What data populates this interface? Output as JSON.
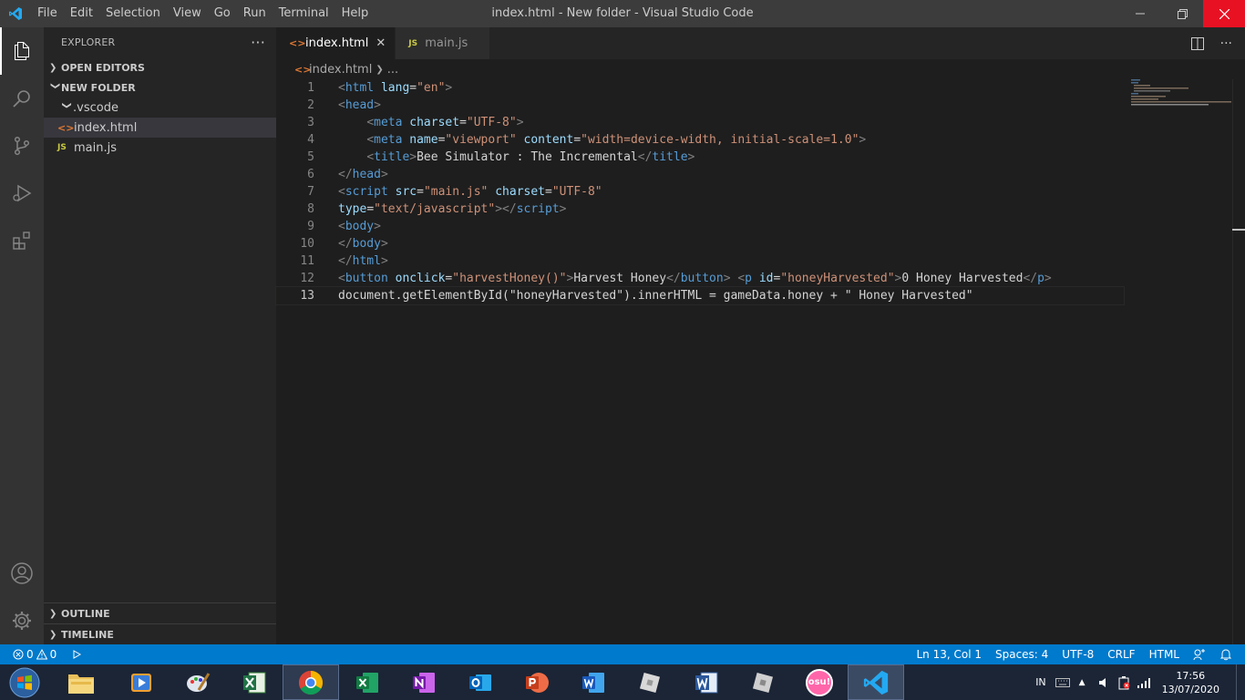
{
  "titlebar": {
    "menu": [
      "File",
      "Edit",
      "Selection",
      "View",
      "Go",
      "Run",
      "Terminal",
      "Help"
    ],
    "title": "index.html - New folder - Visual Studio Code"
  },
  "sidebar": {
    "header": "EXPLORER",
    "more": "···",
    "open_editors": "OPEN EDITORS",
    "folder": "NEW FOLDER",
    "items": [
      {
        "label": ".vscode",
        "type": "folder"
      },
      {
        "label": "index.html",
        "type": "html",
        "icon": "<>"
      },
      {
        "label": "main.js",
        "type": "js",
        "icon": "JS"
      }
    ],
    "outline": "OUTLINE",
    "timeline": "TIMELINE"
  },
  "tabs": [
    {
      "label": "index.html",
      "icon": "<>",
      "active": true
    },
    {
      "label": "main.js",
      "icon": "JS",
      "active": false
    }
  ],
  "breadcrumb": {
    "file": "index.html",
    "rest": "..."
  },
  "code": {
    "current_line": 13,
    "lines": [
      [
        {
          "c": "t",
          "s": "<"
        },
        {
          "c": "tag",
          "s": "html"
        },
        {
          "c": "plain",
          "s": " "
        },
        {
          "c": "attr",
          "s": "lang"
        },
        {
          "c": "plain",
          "s": "="
        },
        {
          "c": "str",
          "s": "\"en\""
        },
        {
          "c": "t",
          "s": ">"
        }
      ],
      [
        {
          "c": "t",
          "s": "<"
        },
        {
          "c": "tag",
          "s": "head"
        },
        {
          "c": "t",
          "s": ">"
        }
      ],
      [
        {
          "c": "plain",
          "s": "    "
        },
        {
          "c": "t",
          "s": "<"
        },
        {
          "c": "tag",
          "s": "meta"
        },
        {
          "c": "plain",
          "s": " "
        },
        {
          "c": "attr",
          "s": "charset"
        },
        {
          "c": "plain",
          "s": "="
        },
        {
          "c": "str",
          "s": "\"UTF-8\""
        },
        {
          "c": "t",
          "s": ">"
        }
      ],
      [
        {
          "c": "plain",
          "s": "    "
        },
        {
          "c": "t",
          "s": "<"
        },
        {
          "c": "tag",
          "s": "meta"
        },
        {
          "c": "plain",
          "s": " "
        },
        {
          "c": "attr",
          "s": "name"
        },
        {
          "c": "plain",
          "s": "="
        },
        {
          "c": "str",
          "s": "\"viewport\""
        },
        {
          "c": "plain",
          "s": " "
        },
        {
          "c": "attr",
          "s": "content"
        },
        {
          "c": "plain",
          "s": "="
        },
        {
          "c": "str",
          "s": "\"width=device-width, initial-scale=1.0\""
        },
        {
          "c": "t",
          "s": ">"
        }
      ],
      [
        {
          "c": "plain",
          "s": "    "
        },
        {
          "c": "t",
          "s": "<"
        },
        {
          "c": "tag",
          "s": "title"
        },
        {
          "c": "t",
          "s": ">"
        },
        {
          "c": "plain",
          "s": "Bee Simulator : The Incremental"
        },
        {
          "c": "t",
          "s": "</"
        },
        {
          "c": "tag",
          "s": "title"
        },
        {
          "c": "t",
          "s": ">"
        }
      ],
      [
        {
          "c": "t",
          "s": "</"
        },
        {
          "c": "tag",
          "s": "head"
        },
        {
          "c": "t",
          "s": ">"
        }
      ],
      [
        {
          "c": "t",
          "s": "<"
        },
        {
          "c": "tag",
          "s": "script"
        },
        {
          "c": "plain",
          "s": " "
        },
        {
          "c": "attr",
          "s": "src"
        },
        {
          "c": "plain",
          "s": "="
        },
        {
          "c": "str",
          "s": "\"main.js\""
        },
        {
          "c": "plain",
          "s": " "
        },
        {
          "c": "attr",
          "s": "charset"
        },
        {
          "c": "plain",
          "s": "="
        },
        {
          "c": "str",
          "s": "\"UTF-8\""
        }
      ],
      [
        {
          "c": "attr",
          "s": "type"
        },
        {
          "c": "plain",
          "s": "="
        },
        {
          "c": "str",
          "s": "\"text/javascript\""
        },
        {
          "c": "t",
          "s": "></"
        },
        {
          "c": "tag",
          "s": "script"
        },
        {
          "c": "t",
          "s": ">"
        }
      ],
      [
        {
          "c": "t",
          "s": "<"
        },
        {
          "c": "tag",
          "s": "body"
        },
        {
          "c": "t",
          "s": ">"
        }
      ],
      [
        {
          "c": "t",
          "s": "</"
        },
        {
          "c": "tag",
          "s": "body"
        },
        {
          "c": "t",
          "s": ">"
        }
      ],
      [
        {
          "c": "t",
          "s": "</"
        },
        {
          "c": "tag",
          "s": "html"
        },
        {
          "c": "t",
          "s": ">"
        }
      ],
      [
        {
          "c": "t",
          "s": "<"
        },
        {
          "c": "tag",
          "s": "button"
        },
        {
          "c": "plain",
          "s": " "
        },
        {
          "c": "attr",
          "s": "onclick"
        },
        {
          "c": "plain",
          "s": "="
        },
        {
          "c": "str",
          "s": "\"harvestHoney()\""
        },
        {
          "c": "t",
          "s": ">"
        },
        {
          "c": "plain",
          "s": "Harvest Honey"
        },
        {
          "c": "t",
          "s": "</"
        },
        {
          "c": "tag",
          "s": "button"
        },
        {
          "c": "t",
          "s": ">"
        },
        {
          "c": "plain",
          "s": " "
        },
        {
          "c": "t",
          "s": "<"
        },
        {
          "c": "tag",
          "s": "p"
        },
        {
          "c": "plain",
          "s": " "
        },
        {
          "c": "attr",
          "s": "id"
        },
        {
          "c": "plain",
          "s": "="
        },
        {
          "c": "str",
          "s": "\"honeyHarvested\""
        },
        {
          "c": "t",
          "s": ">"
        },
        {
          "c": "plain",
          "s": "0 Honey Harvested"
        },
        {
          "c": "t",
          "s": "</"
        },
        {
          "c": "tag",
          "s": "p"
        },
        {
          "c": "t",
          "s": ">"
        }
      ],
      [
        {
          "c": "plain",
          "s": "document.getElementById(\"honeyHarvested\").innerHTML = gameData.honey + \" Honey Harvested\""
        }
      ]
    ]
  },
  "statusbar": {
    "errors": "0",
    "warnings": "0",
    "position": "Ln 13, Col 1",
    "spaces": "Spaces: 4",
    "encoding": "UTF-8",
    "eol": "CRLF",
    "language": "HTML"
  },
  "taskbar": {
    "apps": [
      "file-explorer",
      "media-player",
      "paint",
      "excel-2010",
      "chrome",
      "excel",
      "onenote",
      "outlook",
      "powerpoint",
      "word",
      "roblox-studio",
      "word-2010",
      "roblox",
      "osu",
      "vscode"
    ],
    "active_app": "vscode",
    "osu_label": "osu!",
    "language": "IN",
    "time": "17:56",
    "date": "13/07/2020"
  },
  "colors": {
    "accent": "#007acc",
    "tag": "#569cd6",
    "attr": "#9cdcfe",
    "string": "#ce9178",
    "close": "#e81123"
  }
}
